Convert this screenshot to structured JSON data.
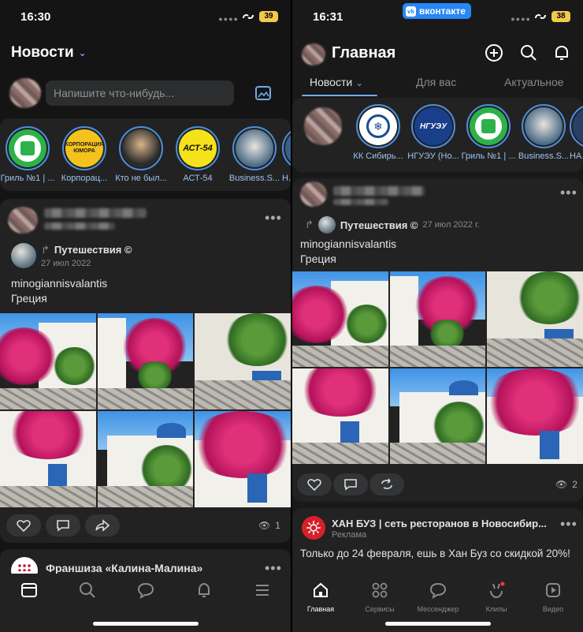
{
  "left": {
    "status": {
      "time": "16:30",
      "battery": "39"
    },
    "feed_title": "Новости",
    "compose_placeholder": "Напишите что-нибудь...",
    "stories": [
      {
        "label": "Гриль №1 | ..."
      },
      {
        "label": "Корпорац..."
      },
      {
        "label": "Кто не был..."
      },
      {
        "label": "АСТ-54"
      },
      {
        "label": "Business.S..."
      },
      {
        "label": "Н..."
      }
    ],
    "story_texts": {
      "korporaciya": "КОРПОРАЦИЯ ЮМОРА",
      "ast": "АСТ-54"
    },
    "post": {
      "source": "Путешествия ©",
      "date": "27 июл 2022",
      "text_line1": "minogiannisvalantis",
      "text_line2": "Греция",
      "views": "1"
    },
    "next_post_title": "Франшиза «Калина-Малина»",
    "tabbar": {
      "items": [
        "home",
        "search",
        "messages",
        "notifications",
        "menu"
      ]
    }
  },
  "right": {
    "status": {
      "time": "16:31",
      "battery": "38",
      "badge": "вконтакте"
    },
    "title": "Главная",
    "tabs": [
      {
        "label": "Новости"
      },
      {
        "label": "Для вас"
      },
      {
        "label": "Актуальное"
      }
    ],
    "stories": [
      {
        "label": ""
      },
      {
        "label": "КК Сибирь..."
      },
      {
        "label": "НГУЭУ (Но..."
      },
      {
        "label": "Гриль №1 | ..."
      },
      {
        "label": "Business.S..."
      },
      {
        "label": "НАС..."
      }
    ],
    "story_texts": {
      "nsuem": "НГУЭУ"
    },
    "post": {
      "source": "Путешествия ©",
      "date": "27 июл 2022 г.",
      "text_line1": "minogiannisvalantis",
      "text_line2": "Греция",
      "views": "2"
    },
    "ad": {
      "title": "ХАН БУЗ | сеть ресторанов в Новосибир...",
      "label": "Реклама",
      "text": "Только до 24 февраля, ешь в Хан Буз со скидкой 20%!"
    },
    "tabbar": {
      "items": [
        {
          "label": "Главная"
        },
        {
          "label": "Сервисы"
        },
        {
          "label": "Мессенджер"
        },
        {
          "label": "Клипы"
        },
        {
          "label": "Видео"
        }
      ]
    }
  },
  "colors": {
    "accent": "#71aaeb",
    "vk_blue": "#2787f5",
    "background": "#141414",
    "card": "#222222"
  }
}
